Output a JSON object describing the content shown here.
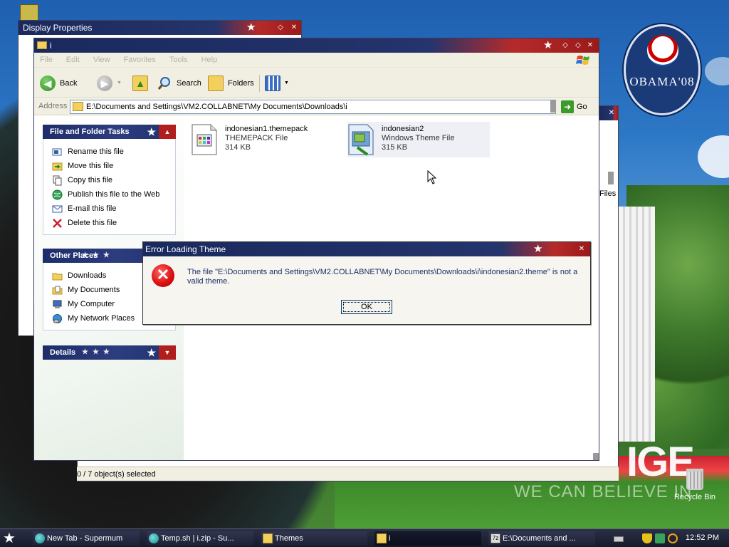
{
  "desktop": {
    "logo_text": "OBAMA'08",
    "slogan_big": "IGE",
    "slogan_small": "WE CAN BELIEVE IN",
    "recycle_bin_label": "Recycle Bin"
  },
  "display_properties": {
    "title": "Display Properties"
  },
  "back_window": {
    "partial_text": "Files"
  },
  "explorer": {
    "title": "i",
    "menu": [
      "File",
      "Edit",
      "View",
      "Favorites",
      "Tools",
      "Help"
    ],
    "toolbar": {
      "back_label": "Back",
      "search_label": "Search",
      "folders_label": "Folders"
    },
    "address": {
      "label": "Address",
      "value": "E:\\Documents and Settings\\VM2.COLLABNET\\My Documents\\Downloads\\i",
      "go_label": "Go"
    },
    "file_tasks": {
      "title": "File and Folder Tasks",
      "items": [
        {
          "label": "Rename this file",
          "icon": "rename-icon"
        },
        {
          "label": "Move this file",
          "icon": "move-icon"
        },
        {
          "label": "Copy this file",
          "icon": "copy-icon"
        },
        {
          "label": "Publish this file to the Web",
          "icon": "globe-icon"
        },
        {
          "label": "E-mail this file",
          "icon": "email-icon"
        },
        {
          "label": "Delete this file",
          "icon": "delete-icon"
        }
      ]
    },
    "other_places": {
      "title": "Other Places",
      "items": [
        {
          "label": "Downloads",
          "icon": "folder-icon"
        },
        {
          "label": "My Documents",
          "icon": "my-documents-icon"
        },
        {
          "label": "My Computer",
          "icon": "my-computer-icon"
        },
        {
          "label": "My Network Places",
          "icon": "network-icon"
        }
      ]
    },
    "details": {
      "title": "Details"
    },
    "files": [
      {
        "name": "indonesian1.themepack",
        "type": "THEMEPACK File",
        "size": "314 KB"
      },
      {
        "name": "indonesian2",
        "type": "Windows Theme File",
        "size": "315 KB"
      }
    ],
    "status": "0 / 7 object(s) selected"
  },
  "dialog": {
    "title": "Error Loading Theme",
    "message": "The file \"E:\\Documents and Settings\\VM2.COLLABNET\\My Documents\\Downloads\\i\\indonesian2.theme\" is not a valid theme.",
    "ok_label": "OK"
  },
  "taskbar": {
    "buttons": [
      {
        "label": "New Tab - Supermum",
        "icon": "browser-icon"
      },
      {
        "label": "Temp.sh | i.zip - Su...",
        "icon": "browser-icon"
      },
      {
        "label": "Themes",
        "icon": "folder-icon"
      },
      {
        "label": "i",
        "icon": "folder-icon"
      },
      {
        "label": "E:\\Documents and ...",
        "icon": "zip-icon"
      }
    ],
    "clock": "12:52 PM"
  },
  "colors": {
    "titlebar_navy": "#1a2a5e",
    "titlebar_red": "#b52a2a",
    "panel_header": "#1e2d6a",
    "xp_bg": "#f1efe2"
  }
}
